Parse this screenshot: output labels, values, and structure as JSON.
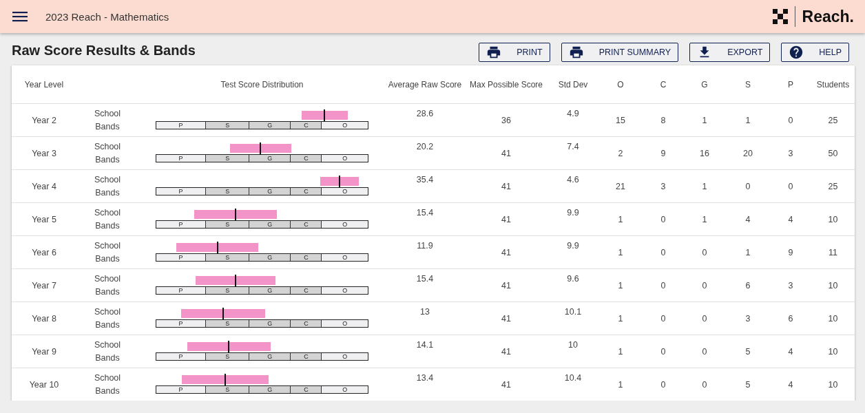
{
  "app_bar": {
    "title": "2023 Reach - Mathematics",
    "logo_text": "Reach."
  },
  "page": {
    "title": "Raw Score Results & Bands"
  },
  "actions": [
    {
      "kind": "print",
      "label": "PRINT"
    },
    {
      "kind": "print",
      "label": "PRINT SUMMARY"
    },
    {
      "kind": "export",
      "label": "EXPORT"
    },
    {
      "kind": "help",
      "label": "HELP"
    }
  ],
  "table": {
    "columns": [
      "Year Level",
      "",
      "Test Score Distribution",
      "Average Raw Score",
      "Max Possible Score",
      "Std Dev",
      "O",
      "C",
      "G",
      "S",
      "P",
      "Students"
    ],
    "rows": [
      {
        "year": "Year 2",
        "label": "School Bands",
        "bands": [
          "P",
          "S",
          "G",
          "C",
          "O"
        ],
        "average": "28.6",
        "max": "36",
        "std_dev": "4.9",
        "o": "15",
        "c": "8",
        "g": "1",
        "s": "1",
        "p": "0",
        "students": "25"
      },
      {
        "year": "Year 3",
        "label": "School Bands",
        "bands": [
          "P",
          "S",
          "G",
          "C",
          "O"
        ],
        "average": "20.2",
        "max": "41",
        "std_dev": "7.4",
        "o": "2",
        "c": "9",
        "g": "16",
        "s": "20",
        "p": "3",
        "students": "50"
      },
      {
        "year": "Year 4",
        "label": "School Bands",
        "bands": [
          "P",
          "S",
          "G",
          "C",
          "O"
        ],
        "average": "35.4",
        "max": "41",
        "std_dev": "4.6",
        "o": "21",
        "c": "3",
        "g": "1",
        "s": "0",
        "p": "0",
        "students": "25"
      },
      {
        "year": "Year 5",
        "label": "School Bands",
        "bands": [
          "P",
          "S",
          "G",
          "C",
          "O"
        ],
        "average": "15.4",
        "max": "41",
        "std_dev": "9.9",
        "o": "1",
        "c": "0",
        "g": "1",
        "s": "4",
        "p": "4",
        "students": "10"
      },
      {
        "year": "Year 6",
        "label": "School Bands",
        "bands": [
          "P",
          "S",
          "G",
          "C",
          "O"
        ],
        "average": "11.9",
        "max": "41",
        "std_dev": "9.9",
        "o": "1",
        "c": "0",
        "g": "0",
        "s": "1",
        "p": "9",
        "students": "11"
      },
      {
        "year": "Year 7",
        "label": "School Bands",
        "bands": [
          "P",
          "S",
          "G",
          "C",
          "O"
        ],
        "average": "15.4",
        "max": "41",
        "std_dev": "9.6",
        "o": "1",
        "c": "0",
        "g": "0",
        "s": "6",
        "p": "3",
        "students": "10"
      },
      {
        "year": "Year 8",
        "label": "School Bands",
        "bands": [
          "P",
          "S",
          "G",
          "C",
          "O"
        ],
        "average": "13",
        "max": "41",
        "std_dev": "10.1",
        "o": "1",
        "c": "0",
        "g": "0",
        "s": "3",
        "p": "6",
        "students": "10"
      },
      {
        "year": "Year 9",
        "label": "School Bands",
        "bands": [
          "P",
          "S",
          "G",
          "C",
          "O"
        ],
        "average": "14.1",
        "max": "41",
        "std_dev": "10",
        "o": "1",
        "c": "0",
        "g": "0",
        "s": "5",
        "p": "4",
        "students": "10"
      },
      {
        "year": "Year 10",
        "label": "School Bands",
        "bands": [
          "P",
          "S",
          "G",
          "C",
          "O"
        ],
        "average": "13.4",
        "max": "41",
        "std_dev": "10.4",
        "o": "1",
        "c": "0",
        "g": "0",
        "s": "5",
        "p": "4",
        "students": "10"
      }
    ]
  }
}
